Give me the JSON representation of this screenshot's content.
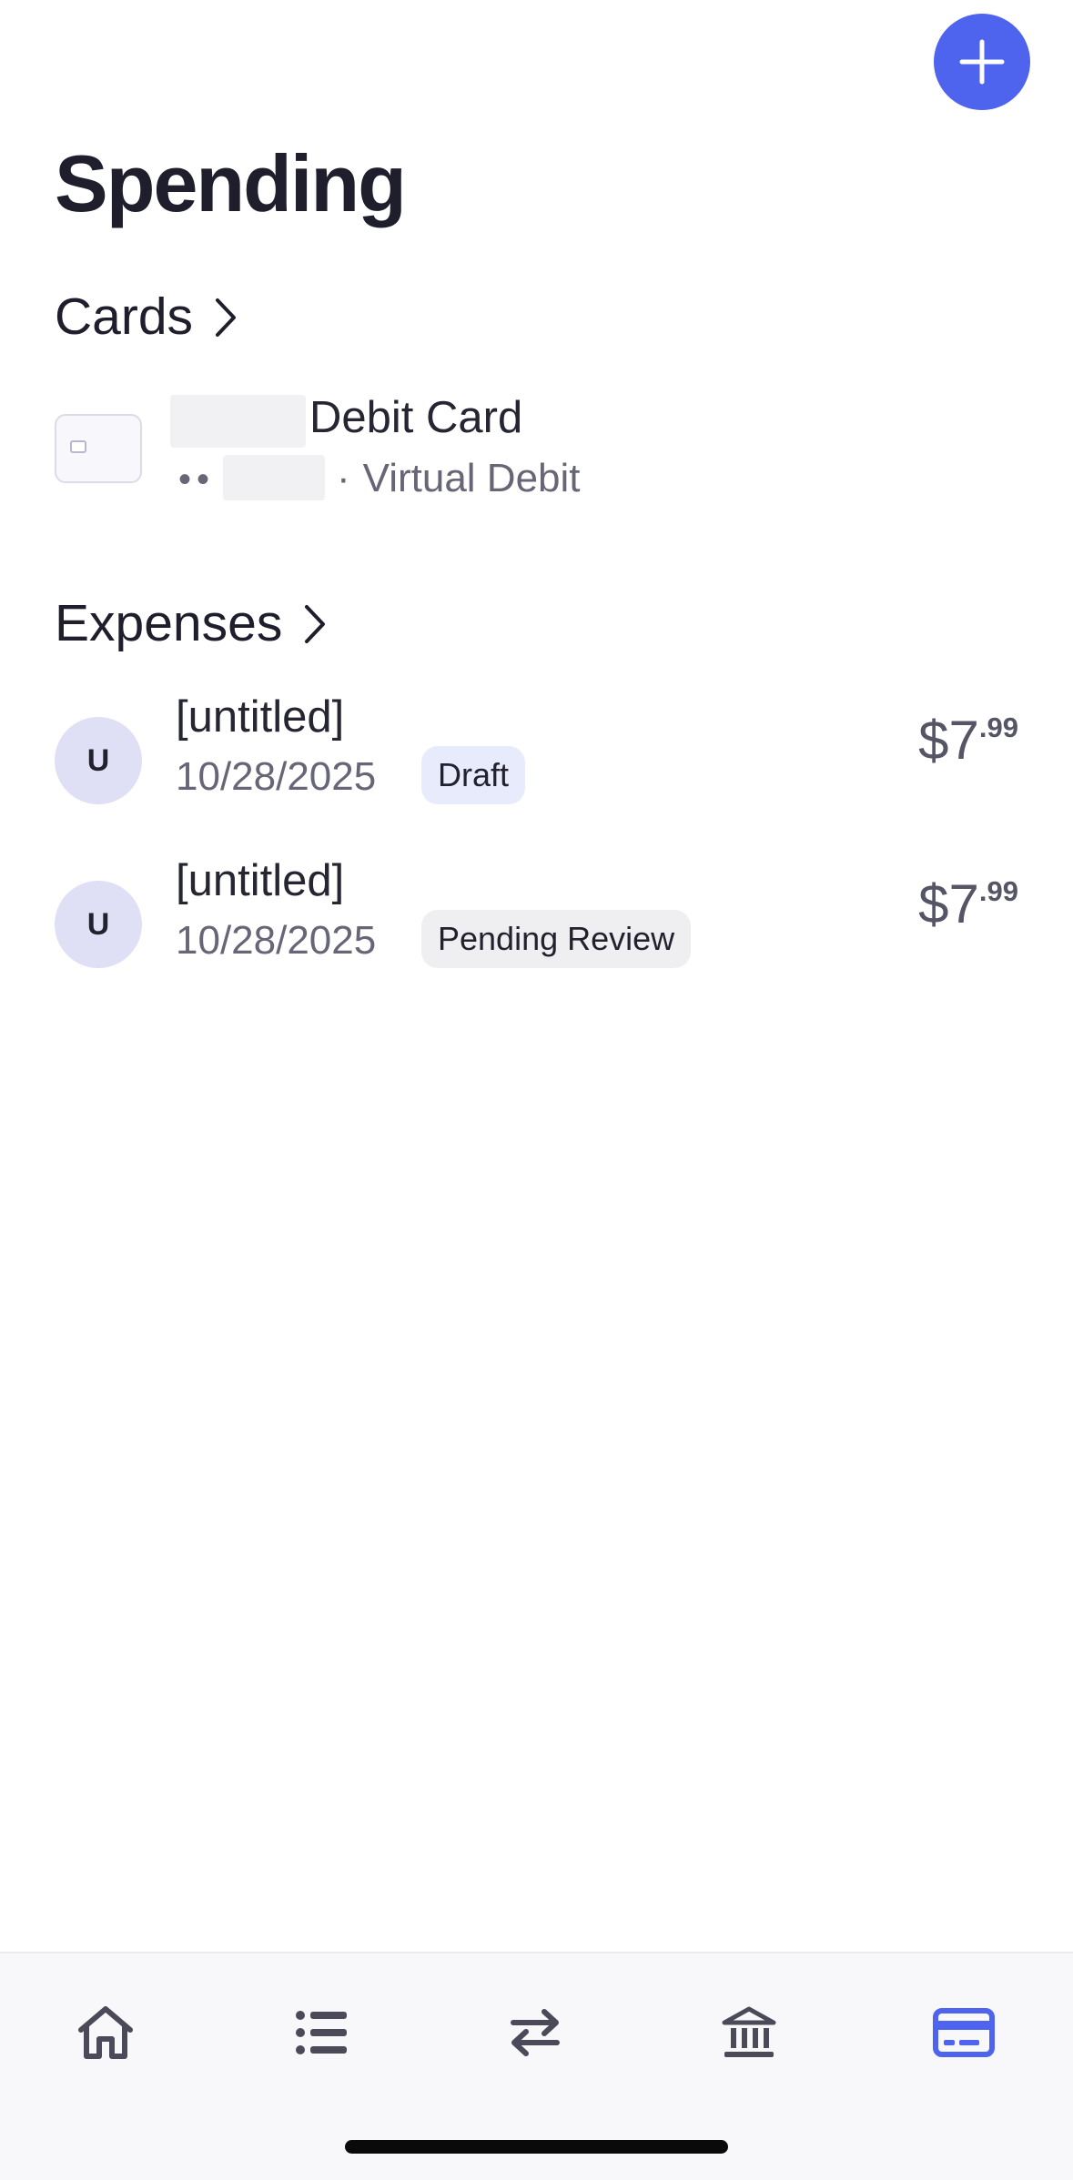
{
  "page": {
    "title": "Spending",
    "accent_color": "#4f64ee"
  },
  "fab": {
    "icon": "plus-icon"
  },
  "cards_section": {
    "title": "Cards",
    "items": [
      {
        "name": "Debit Card",
        "masked_number": "••",
        "separator": "·",
        "type": "Virtual Debit"
      }
    ]
  },
  "expenses_section": {
    "title": "Expenses",
    "items": [
      {
        "avatar": "U",
        "title": "[untitled]",
        "date": "10/28/2025",
        "status": "Draft",
        "amount_whole": "$7",
        "amount_cents": ".99"
      },
      {
        "avatar": "U",
        "title": "[untitled]",
        "date": "10/28/2025",
        "status": "Pending Review",
        "amount_whole": "$7",
        "amount_cents": ".99"
      }
    ]
  },
  "tab_bar": {
    "tabs": [
      {
        "icon": "home-icon",
        "active": false
      },
      {
        "icon": "list-icon",
        "active": false
      },
      {
        "icon": "transfer-arrows-icon",
        "active": false
      },
      {
        "icon": "bank-icon",
        "active": false
      },
      {
        "icon": "credit-card-icon",
        "active": true
      }
    ],
    "active_color": "#4f64ee",
    "inactive_color": "#4a4a58"
  }
}
